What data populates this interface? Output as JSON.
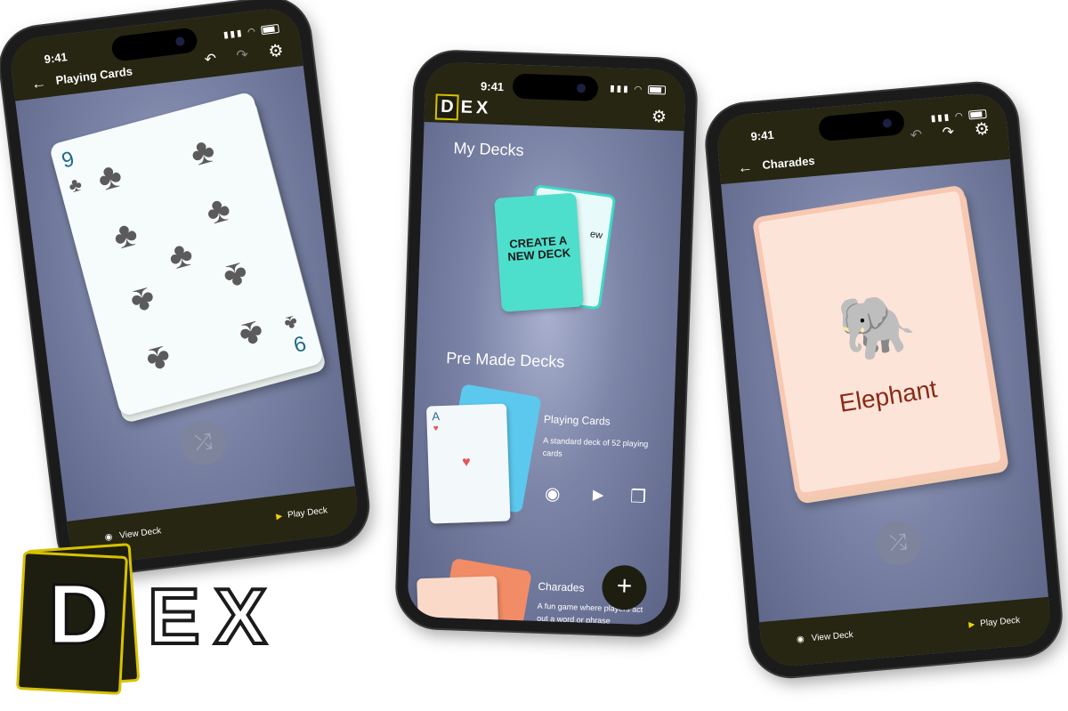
{
  "phones": {
    "left": {
      "time": "9:41",
      "title": "Playing Cards",
      "card": {
        "rank_top": "9",
        "rank_bottom": "6"
      },
      "bottom": {
        "view_label": "View Deck",
        "play_label": "Play Deck"
      }
    },
    "center": {
      "time": "9:41",
      "logo": {
        "d": "D",
        "ex": "EX"
      },
      "my_decks_heading": "My Decks",
      "create_card": {
        "front_text": "CREATE A NEW DECK",
        "back_text": "ew"
      },
      "premade_heading": "Pre Made Decks",
      "decks": [
        {
          "name": "Playing Cards",
          "description": "A standard deck of 52 playing cards",
          "card_rank": "A"
        },
        {
          "name": "Charades",
          "description": "A fun game where players act out a word or phrase"
        }
      ],
      "fab_label": "+"
    },
    "right": {
      "time": "9:41",
      "title": "Charades",
      "card": {
        "emoji": "🐘",
        "word": "Elephant"
      },
      "bottom": {
        "view_label": "View Deck",
        "play_label": "Play Deck"
      }
    }
  },
  "brand": {
    "d": "D",
    "ex": "EX"
  },
  "colors": {
    "bar_bg": "#262612",
    "accent_yellow": "#d7c200",
    "teal": "#4edfcc",
    "peach": "#fde4d8",
    "club_gray": "#5b5b5b"
  }
}
